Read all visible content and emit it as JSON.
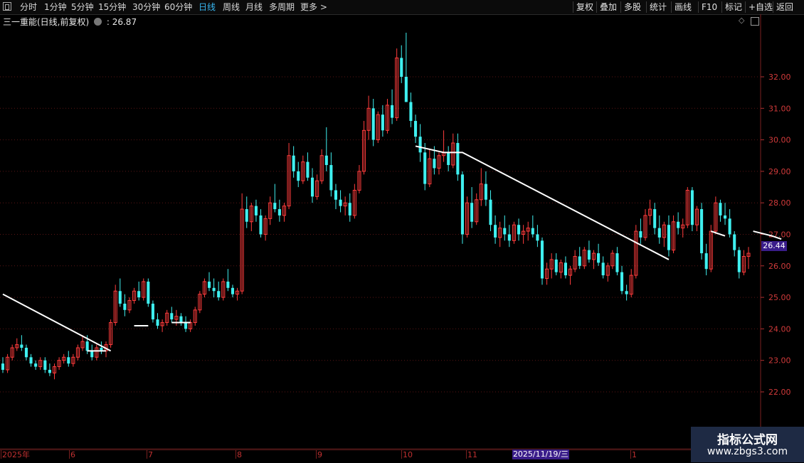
{
  "toolbar": {
    "periods": [
      "分时",
      "1分钟",
      "5分钟",
      "15分钟",
      "30分钟",
      "60分钟",
      "日线",
      "周线",
      "月线",
      "多周期",
      "更多 >"
    ],
    "active_period": "日线",
    "right_buttons": [
      "复权",
      "叠加",
      "多股",
      "统计",
      "画线",
      "F10",
      "标记",
      "+自选",
      "返回"
    ]
  },
  "stock": {
    "title": "三一重能(日线,前复权)",
    "separator": ":",
    "price_label": "26.87"
  },
  "axis": {
    "price_ticks": [
      "32.00",
      "31.00",
      "30.00",
      "29.00",
      "28.00",
      "27.00",
      "26.00",
      "25.00",
      "24.00",
      "23.00",
      "22.00"
    ],
    "current_price_tag": "26.44",
    "date_labels": [
      "2025年",
      "6",
      "7",
      "8",
      "9",
      "10",
      "11",
      "1"
    ],
    "highlight_date": "2025/11/19/三"
  },
  "watermark": {
    "line1": "指标公式网",
    "line2": "www.zbgs3.com"
  },
  "colors": {
    "up": "#ff3c3c",
    "down": "#3ff0f0",
    "trendline": "#ffffff",
    "active": "#38b6f0",
    "price_tag_bg": "#3a1d8a",
    "grid": "#5a1515"
  },
  "chart_data": {
    "type": "candlestick",
    "ylim": [
      21.5,
      33.5
    ],
    "y_ticks": [
      22,
      23,
      24,
      25,
      26,
      27,
      28,
      29,
      30,
      31,
      32
    ],
    "candles": [
      [
        22.9,
        23.1,
        22.6,
        22.7
      ],
      [
        22.7,
        23.2,
        22.6,
        23.1
      ],
      [
        23.1,
        23.5,
        23.0,
        23.4
      ],
      [
        23.4,
        23.7,
        23.3,
        23.5
      ],
      [
        23.5,
        23.8,
        23.3,
        23.4
      ],
      [
        23.4,
        23.5,
        23.0,
        23.1
      ],
      [
        23.1,
        23.2,
        22.8,
        22.9
      ],
      [
        22.9,
        23.0,
        22.7,
        22.8
      ],
      [
        22.8,
        23.1,
        22.7,
        23.0
      ],
      [
        23.0,
        23.1,
        22.6,
        22.7
      ],
      [
        22.7,
        22.9,
        22.5,
        22.6
      ],
      [
        22.6,
        22.9,
        22.4,
        22.8
      ],
      [
        22.8,
        23.1,
        22.7,
        23.0
      ],
      [
        23.0,
        23.2,
        22.9,
        23.1
      ],
      [
        23.1,
        23.3,
        22.8,
        22.9
      ],
      [
        22.9,
        23.2,
        22.8,
        23.1
      ],
      [
        23.1,
        23.5,
        23.0,
        23.4
      ],
      [
        23.4,
        23.8,
        23.3,
        23.6
      ],
      [
        23.6,
        23.8,
        23.2,
        23.3
      ],
      [
        23.3,
        23.5,
        23.0,
        23.1
      ],
      [
        23.1,
        23.5,
        23.0,
        23.4
      ],
      [
        23.4,
        23.6,
        23.2,
        23.3
      ],
      [
        23.3,
        23.6,
        23.1,
        23.5
      ],
      [
        23.5,
        24.3,
        23.4,
        24.2
      ],
      [
        24.2,
        25.4,
        24.1,
        25.2
      ],
      [
        25.2,
        25.6,
        24.7,
        24.8
      ],
      [
        24.8,
        25.1,
        24.4,
        24.6
      ],
      [
        24.6,
        25.0,
        24.5,
        24.9
      ],
      [
        24.9,
        25.3,
        24.8,
        25.2
      ],
      [
        25.2,
        25.5,
        24.9,
        25.0
      ],
      [
        25.0,
        25.6,
        24.9,
        25.5
      ],
      [
        25.5,
        25.6,
        24.7,
        24.8
      ],
      [
        24.8,
        24.9,
        24.2,
        24.3
      ],
      [
        24.3,
        24.5,
        24.0,
        24.1
      ],
      [
        24.1,
        24.3,
        23.9,
        24.2
      ],
      [
        24.2,
        24.6,
        24.1,
        24.5
      ],
      [
        24.5,
        24.7,
        24.2,
        24.3
      ],
      [
        24.3,
        24.6,
        24.1,
        24.4
      ],
      [
        24.4,
        24.5,
        24.1,
        24.2
      ],
      [
        24.2,
        24.4,
        23.9,
        24.0
      ],
      [
        24.0,
        24.3,
        23.9,
        24.2
      ],
      [
        24.2,
        24.7,
        24.1,
        24.6
      ],
      [
        24.6,
        25.2,
        24.5,
        25.1
      ],
      [
        25.1,
        25.6,
        25.0,
        25.5
      ],
      [
        25.5,
        25.8,
        25.2,
        25.3
      ],
      [
        25.3,
        25.6,
        25.0,
        25.2
      ],
      [
        25.2,
        25.5,
        24.9,
        25.0
      ],
      [
        25.0,
        25.6,
        24.9,
        25.5
      ],
      [
        25.5,
        25.9,
        25.2,
        25.3
      ],
      [
        25.3,
        25.4,
        25.0,
        25.1
      ],
      [
        25.1,
        25.3,
        24.9,
        25.2
      ],
      [
        25.2,
        28.3,
        25.1,
        27.8
      ],
      [
        27.8,
        28.2,
        27.2,
        27.4
      ],
      [
        27.4,
        28.0,
        27.1,
        27.9
      ],
      [
        27.9,
        28.1,
        27.4,
        27.6
      ],
      [
        27.6,
        27.8,
        26.9,
        27.0
      ],
      [
        27.0,
        27.6,
        26.8,
        27.5
      ],
      [
        27.5,
        28.2,
        27.3,
        28.0
      ],
      [
        28.0,
        28.6,
        27.7,
        27.8
      ],
      [
        27.8,
        28.1,
        27.4,
        27.6
      ],
      [
        27.6,
        28.0,
        27.4,
        27.9
      ],
      [
        27.9,
        29.9,
        27.8,
        29.5
      ],
      [
        29.5,
        29.8,
        28.8,
        29.0
      ],
      [
        29.0,
        29.3,
        28.5,
        28.7
      ],
      [
        28.7,
        29.5,
        28.6,
        29.3
      ],
      [
        29.3,
        29.6,
        28.7,
        28.8
      ],
      [
        28.8,
        29.1,
        28.0,
        28.2
      ],
      [
        28.2,
        28.9,
        28.1,
        28.7
      ],
      [
        28.7,
        29.7,
        28.6,
        29.5
      ],
      [
        29.5,
        30.4,
        29.0,
        29.2
      ],
      [
        29.2,
        29.6,
        28.2,
        28.4
      ],
      [
        28.4,
        28.6,
        27.8,
        28.1
      ],
      [
        28.1,
        28.4,
        27.7,
        27.9
      ],
      [
        27.9,
        28.2,
        27.6,
        28.0
      ],
      [
        28.0,
        28.3,
        27.4,
        27.6
      ],
      [
        27.6,
        28.6,
        27.5,
        28.4
      ],
      [
        28.4,
        29.2,
        28.3,
        29.0
      ],
      [
        29.0,
        30.6,
        28.9,
        30.3
      ],
      [
        30.3,
        31.4,
        30.0,
        31.0
      ],
      [
        31.0,
        31.3,
        29.8,
        30.0
      ],
      [
        30.0,
        30.9,
        29.9,
        30.8
      ],
      [
        30.8,
        31.1,
        30.1,
        30.3
      ],
      [
        30.3,
        31.3,
        30.2,
        31.1
      ],
      [
        31.1,
        31.6,
        30.5,
        30.7
      ],
      [
        30.7,
        32.9,
        30.6,
        32.6
      ],
      [
        32.6,
        33.0,
        31.8,
        32.0
      ],
      [
        32.0,
        33.4,
        31.7,
        31.2
      ],
      [
        31.2,
        31.5,
        30.4,
        30.6
      ],
      [
        30.6,
        30.8,
        29.9,
        30.1
      ],
      [
        30.1,
        30.5,
        29.3,
        29.6
      ],
      [
        29.6,
        29.9,
        28.4,
        28.6
      ],
      [
        28.6,
        29.7,
        28.5,
        29.4
      ],
      [
        29.4,
        29.8,
        28.9,
        29.1
      ],
      [
        29.1,
        29.6,
        28.9,
        29.5
      ],
      [
        29.5,
        30.3,
        29.3,
        29.6
      ],
      [
        29.6,
        29.8,
        29.0,
        29.2
      ],
      [
        29.2,
        30.2,
        29.1,
        29.9
      ],
      [
        29.9,
        30.2,
        28.7,
        28.9
      ],
      [
        28.9,
        29.0,
        26.7,
        27.0
      ],
      [
        27.0,
        28.2,
        26.9,
        28.0
      ],
      [
        28.0,
        28.5,
        27.2,
        27.4
      ],
      [
        27.4,
        28.3,
        27.3,
        28.1
      ],
      [
        28.1,
        29.1,
        27.9,
        28.6
      ],
      [
        28.6,
        29.0,
        27.9,
        28.1
      ],
      [
        28.1,
        28.4,
        27.1,
        27.3
      ],
      [
        27.3,
        27.6,
        26.7,
        26.9
      ],
      [
        26.9,
        27.4,
        26.6,
        27.2
      ],
      [
        27.2,
        27.6,
        26.8,
        27.0
      ],
      [
        27.0,
        27.3,
        26.6,
        26.8
      ],
      [
        26.8,
        27.4,
        26.7,
        27.3
      ],
      [
        27.3,
        27.5,
        26.8,
        27.0
      ],
      [
        27.0,
        27.3,
        26.7,
        27.1
      ],
      [
        27.1,
        27.4,
        26.8,
        27.2
      ],
      [
        27.2,
        27.6,
        26.9,
        27.0
      ],
      [
        27.0,
        27.3,
        26.6,
        26.8
      ],
      [
        26.8,
        26.9,
        25.4,
        25.6
      ],
      [
        25.6,
        26.1,
        25.4,
        25.9
      ],
      [
        25.9,
        26.4,
        25.6,
        26.2
      ],
      [
        26.2,
        26.4,
        25.7,
        25.8
      ],
      [
        25.8,
        26.2,
        25.6,
        26.1
      ],
      [
        26.1,
        26.3,
        25.6,
        25.7
      ],
      [
        25.7,
        26.0,
        25.4,
        25.9
      ],
      [
        25.9,
        26.5,
        25.8,
        26.3
      ],
      [
        26.3,
        26.6,
        25.9,
        26.0
      ],
      [
        26.0,
        26.6,
        25.9,
        26.5
      ],
      [
        26.5,
        26.8,
        26.1,
        26.2
      ],
      [
        26.2,
        26.5,
        25.9,
        26.4
      ],
      [
        26.4,
        26.7,
        26.0,
        26.1
      ],
      [
        26.1,
        26.3,
        25.6,
        25.7
      ],
      [
        25.7,
        26.1,
        25.5,
        26.0
      ],
      [
        26.0,
        26.5,
        25.9,
        26.4
      ],
      [
        26.4,
        26.6,
        25.7,
        25.8
      ],
      [
        25.8,
        26.0,
        25.1,
        25.2
      ],
      [
        25.2,
        25.4,
        24.9,
        25.1
      ],
      [
        25.1,
        25.9,
        25.0,
        25.7
      ],
      [
        25.7,
        27.3,
        25.6,
        27.1
      ],
      [
        27.1,
        27.5,
        26.7,
        26.9
      ],
      [
        26.9,
        27.8,
        26.8,
        27.6
      ],
      [
        27.6,
        28.1,
        27.3,
        27.8
      ],
      [
        27.8,
        28.0,
        27.0,
        27.2
      ],
      [
        27.2,
        27.6,
        26.7,
        26.9
      ],
      [
        26.9,
        27.4,
        26.6,
        27.3
      ],
      [
        27.3,
        27.6,
        26.3,
        26.5
      ],
      [
        26.5,
        27.6,
        26.4,
        27.4
      ],
      [
        27.4,
        27.7,
        27.0,
        27.2
      ],
      [
        27.2,
        27.5,
        26.9,
        27.3
      ],
      [
        27.3,
        28.5,
        27.2,
        28.4
      ],
      [
        28.4,
        28.5,
        27.1,
        27.3
      ],
      [
        27.3,
        27.9,
        27.1,
        27.8
      ],
      [
        27.8,
        28.0,
        26.2,
        26.4
      ],
      [
        26.4,
        26.7,
        25.7,
        25.9
      ],
      [
        25.9,
        27.3,
        25.8,
        27.1
      ],
      [
        27.1,
        28.2,
        27.0,
        28.0
      ],
      [
        28.0,
        28.1,
        27.4,
        27.6
      ],
      [
        27.6,
        28.0,
        27.3,
        27.5
      ],
      [
        27.5,
        27.8,
        26.9,
        27.0
      ],
      [
        27.0,
        27.1,
        26.3,
        26.5
      ],
      [
        26.5,
        26.6,
        25.6,
        25.8
      ],
      [
        25.8,
        26.5,
        25.7,
        26.3
      ],
      [
        26.3,
        26.6,
        25.9,
        26.4
      ]
    ],
    "trendlines": [
      {
        "name": "downtrend-1",
        "points": [
          [
            0,
            25.1
          ],
          [
            23,
            23.3
          ]
        ]
      },
      {
        "name": "flat-1",
        "points": [
          [
            28,
            24.1
          ],
          [
            31,
            24.1
          ]
        ]
      },
      {
        "name": "flat-2",
        "points": [
          [
            18,
            23.3
          ],
          [
            22,
            23.3
          ]
        ]
      },
      {
        "name": "flat-3",
        "points": [
          [
            36,
            24.2
          ],
          [
            40,
            24.2
          ]
        ]
      },
      {
        "name": "downtrend-2",
        "points": [
          [
            88,
            29.8
          ],
          [
            94,
            29.6
          ],
          [
            98,
            29.6
          ],
          [
            142,
            26.2
          ]
        ]
      },
      {
        "name": "flat-4",
        "points": [
          [
            151,
            27.1
          ],
          [
            154,
            26.95
          ]
        ]
      },
      {
        "name": "downtrend-3",
        "points": [
          [
            160,
            27.1
          ],
          [
            164,
            26.95
          ],
          [
            166,
            26.85
          ]
        ]
      }
    ]
  }
}
